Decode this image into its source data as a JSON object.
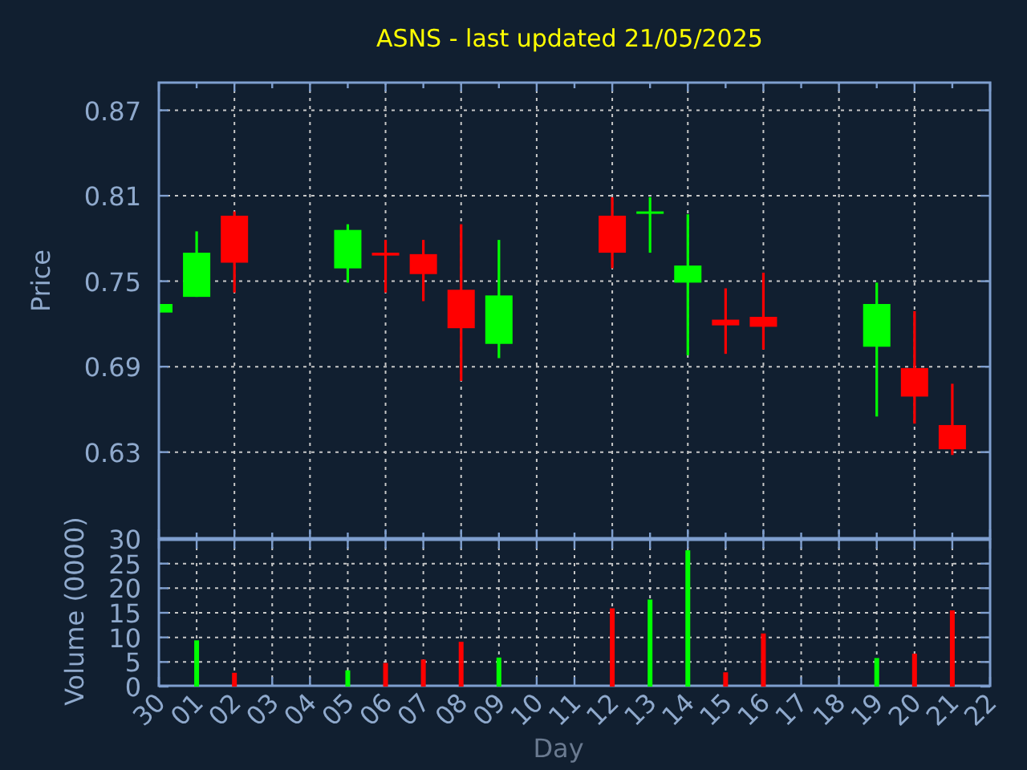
{
  "title": "ASNS - last updated 21/05/2025",
  "price_chart": {
    "chart_data": {
      "type": "candlestick",
      "grid": true,
      "ylabel": "Price",
      "ylim": [
        0.569,
        0.89
      ],
      "categories": [
        null,
        null,
        null,
        null,
        null,
        null,
        null,
        null,
        null,
        null,
        null,
        null,
        null,
        null,
        null,
        null,
        null,
        null,
        null,
        null,
        null,
        null,
        null
      ],
      "yticks": [
        {
          "value": 0.63,
          "label": "0.63"
        },
        {
          "value": 0.69,
          "label": "0.69"
        },
        {
          "value": 0.75,
          "label": "0.75"
        },
        {
          "value": 0.81,
          "label": "0.81"
        },
        {
          "value": 0.87,
          "label": "0.87"
        }
      ],
      "ohlc": [
        [
          0.728,
          0.734,
          0.728,
          0.734
        ],
        [
          0.739,
          0.785,
          0.739,
          0.77
        ],
        [
          0.796,
          0.799,
          0.742,
          0.763
        ],
        null,
        null,
        [
          0.759,
          0.79,
          0.749,
          0.786
        ],
        [
          0.77,
          0.779,
          0.742,
          0.768
        ],
        [
          0.769,
          0.779,
          0.736,
          0.755
        ],
        [
          0.744,
          0.79,
          0.68,
          0.717
        ],
        [
          0.706,
          0.779,
          0.696,
          0.74
        ],
        null,
        null,
        [
          0.796,
          0.809,
          0.759,
          0.77
        ],
        [
          0.798,
          0.809,
          0.77,
          0.799
        ],
        [
          0.749,
          0.797,
          0.698,
          0.761
        ],
        [
          0.723,
          0.745,
          0.699,
          0.719
        ],
        [
          0.725,
          0.756,
          0.702,
          0.718
        ],
        null,
        null,
        [
          0.704,
          0.749,
          0.655,
          0.734
        ],
        [
          0.689,
          0.729,
          0.65,
          0.669
        ],
        [
          0.649,
          0.678,
          0.628,
          0.632
        ],
        null
      ]
    }
  },
  "volume_chart": {
    "chart_data": {
      "type": "bar",
      "grid": true,
      "xlabel": "Day",
      "ylabel": "Volume (0000)",
      "ylim": [
        0,
        30
      ],
      "categories": [
        "30",
        "01",
        "02",
        "03",
        "04",
        "05",
        "06",
        "07",
        "08",
        "09",
        "10",
        "11",
        "12",
        "13",
        "14",
        "15",
        "16",
        "17",
        "18",
        "19",
        "20",
        "21",
        "22"
      ],
      "yticks": [
        {
          "value": 0,
          "label": "0"
        },
        {
          "value": 5,
          "label": "5"
        },
        {
          "value": 10,
          "label": "10"
        },
        {
          "value": 15,
          "label": "15"
        },
        {
          "value": 20,
          "label": "20"
        },
        {
          "value": 25,
          "label": "25"
        },
        {
          "value": 30,
          "label": "30"
        }
      ],
      "values": [
        0,
        9.4,
        2.8,
        null,
        null,
        3.3,
        4.8,
        5.5,
        9.1,
        5.9,
        null,
        null,
        15.9,
        17.7,
        27.7,
        2.9,
        10.8,
        null,
        null,
        5.8,
        6.7,
        15.5,
        null
      ]
    }
  }
}
